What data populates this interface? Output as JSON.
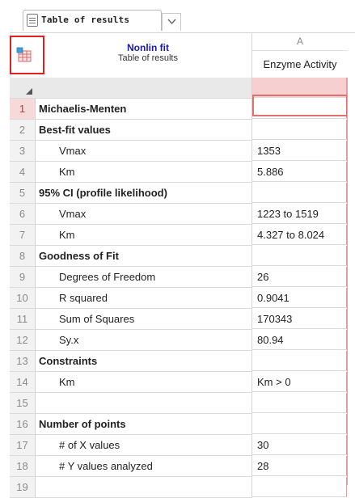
{
  "tab": {
    "title": "Table of results"
  },
  "sheet": {
    "title": "Nonlin fit",
    "subtitle": "Table of results",
    "column_letter": "A",
    "column_title": "Enzyme Activity"
  },
  "rows": [
    {
      "num": "1",
      "label": "Michaelis-Menten",
      "value": "",
      "style": "section"
    },
    {
      "num": "2",
      "label": "Best-fit values",
      "value": "",
      "style": "section"
    },
    {
      "num": "3",
      "label": "Vmax",
      "value": "1353",
      "style": "indent"
    },
    {
      "num": "4",
      "label": "Km",
      "value": "5.886",
      "style": "indent"
    },
    {
      "num": "5",
      "label": "95% CI (profile likelihood)",
      "value": "",
      "style": "section"
    },
    {
      "num": "6",
      "label": "Vmax",
      "value": "1223 to 1519",
      "style": "indent"
    },
    {
      "num": "7",
      "label": "Km",
      "value": "4.327 to 8.024",
      "style": "indent"
    },
    {
      "num": "8",
      "label": "Goodness of Fit",
      "value": "",
      "style": "section"
    },
    {
      "num": "9",
      "label": "Degrees of Freedom",
      "value": "26",
      "style": "indent"
    },
    {
      "num": "10",
      "label": "R squared",
      "value": "0.9041",
      "style": "indent"
    },
    {
      "num": "11",
      "label": "Sum of Squares",
      "value": "170343",
      "style": "indent"
    },
    {
      "num": "12",
      "label": "Sy.x",
      "value": "80.94",
      "style": "indent"
    },
    {
      "num": "13",
      "label": "Constraints",
      "value": "",
      "style": "section"
    },
    {
      "num": "14",
      "label": "Km",
      "value": "Km > 0",
      "style": "indent"
    },
    {
      "num": "15",
      "label": "",
      "value": "",
      "style": "section"
    },
    {
      "num": "16",
      "label": "Number of points",
      "value": "",
      "style": "section"
    },
    {
      "num": "17",
      "label": "# of X values",
      "value": "30",
      "style": "indent"
    },
    {
      "num": "18",
      "label": "# Y values analyzed",
      "value": "28",
      "style": "indent"
    },
    {
      "num": "19",
      "label": "",
      "value": "",
      "style": "section"
    }
  ],
  "icons": {
    "tab": "document-icon",
    "tab_menu": "chevron-down-icon",
    "corner": "table-format-icon"
  },
  "colors": {
    "accent": "#1a1aa8",
    "selection": "#e07070",
    "highlight_row": "#f6d9d9"
  }
}
